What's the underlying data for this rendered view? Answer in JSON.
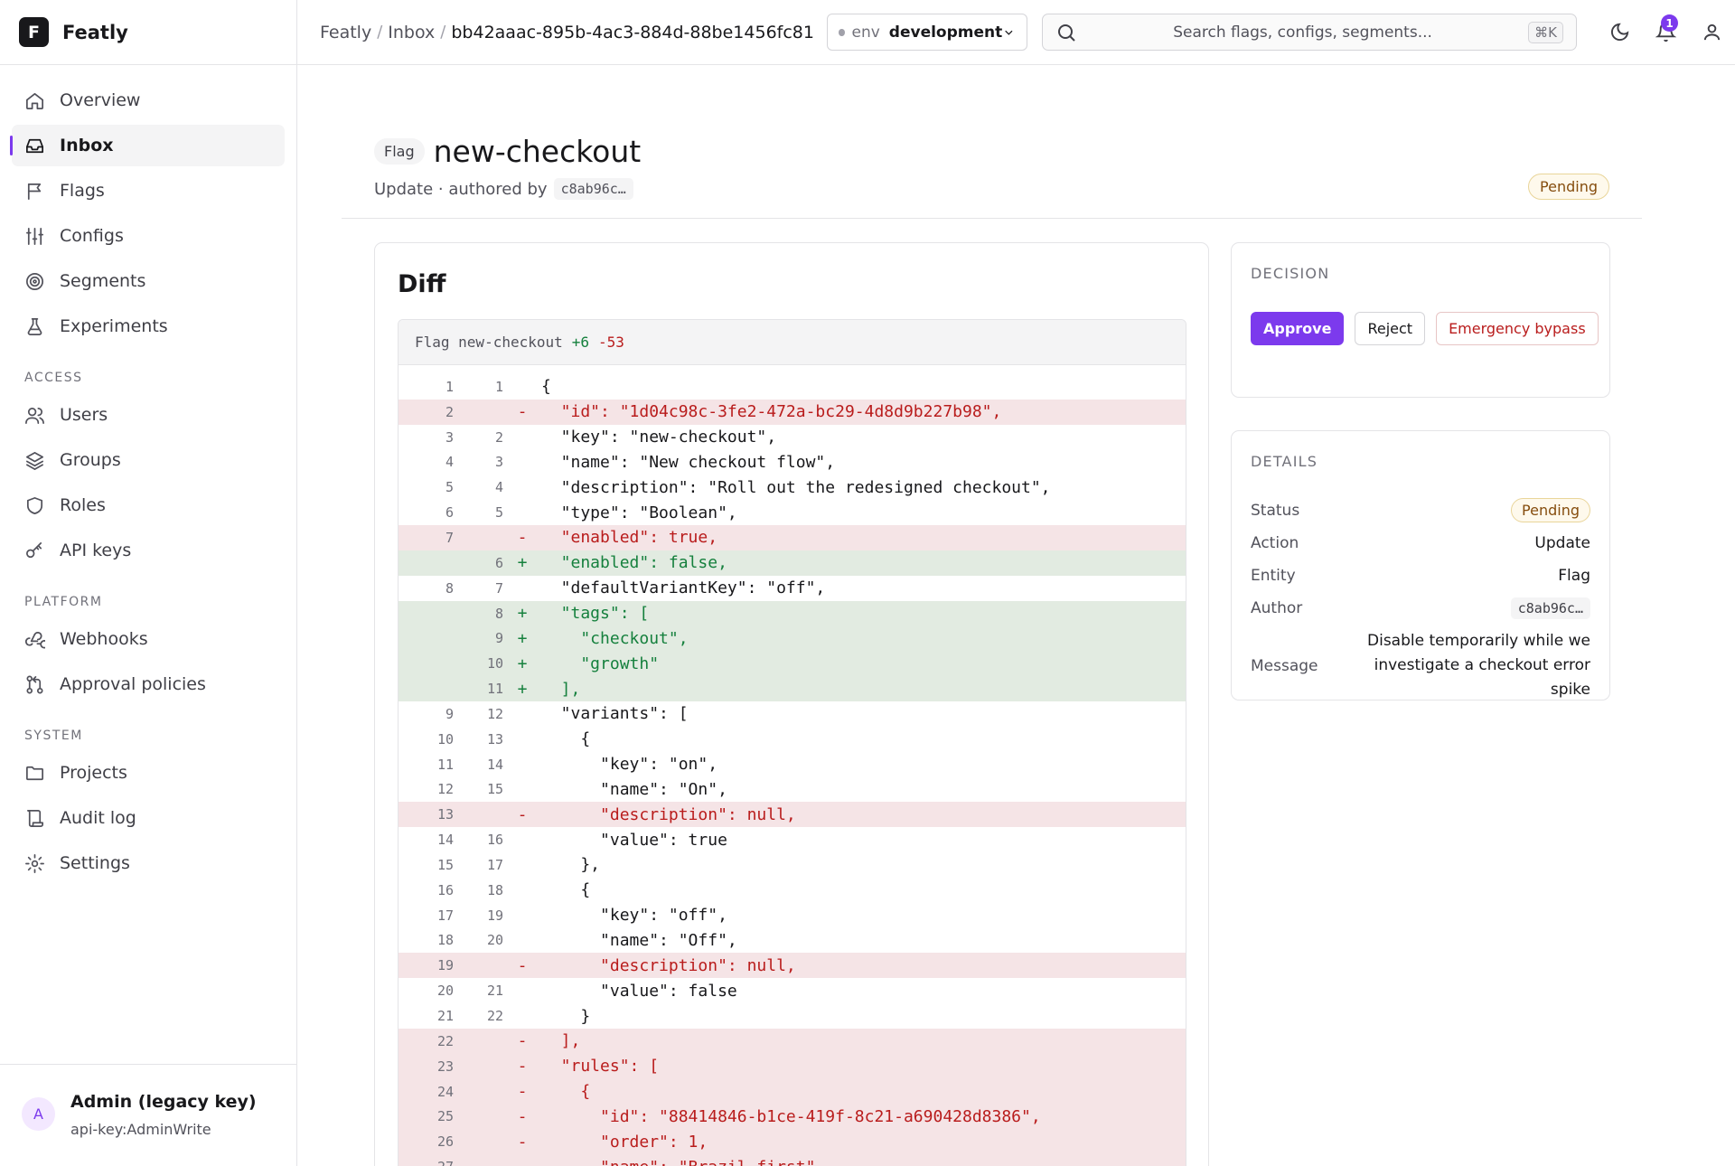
{
  "app": {
    "logo_letter": "F",
    "name": "Featly"
  },
  "nav": {
    "items": [
      {
        "label": "Overview",
        "icon": "home-icon"
      },
      {
        "label": "Inbox",
        "icon": "inbox-icon",
        "active": true
      },
      {
        "label": "Flags",
        "icon": "flag-icon"
      },
      {
        "label": "Configs",
        "icon": "sliders-icon"
      },
      {
        "label": "Segments",
        "icon": "target-icon"
      },
      {
        "label": "Experiments",
        "icon": "flask-icon"
      }
    ],
    "sections": [
      {
        "title": "ACCESS",
        "items": [
          {
            "label": "Users",
            "icon": "users-icon"
          },
          {
            "label": "Groups",
            "icon": "layers-icon"
          },
          {
            "label": "Roles",
            "icon": "shield-icon"
          },
          {
            "label": "API keys",
            "icon": "key-icon"
          }
        ]
      },
      {
        "title": "PLATFORM",
        "items": [
          {
            "label": "Webhooks",
            "icon": "webhook-icon"
          },
          {
            "label": "Approval policies",
            "icon": "git-pull-request-icon"
          }
        ]
      },
      {
        "title": "SYSTEM",
        "items": [
          {
            "label": "Projects",
            "icon": "folder-icon"
          },
          {
            "label": "Audit log",
            "icon": "scroll-icon"
          },
          {
            "label": "Settings",
            "icon": "gear-icon"
          }
        ]
      }
    ]
  },
  "user": {
    "initial": "A",
    "name": "Admin (legacy key)",
    "key": "api-key:AdminWrite"
  },
  "topbar": {
    "breadcrumbs": [
      "Featly",
      "Inbox",
      "bb42aaac-895b-4ac3-884d-88be1456fc81"
    ],
    "env_label": "env",
    "env_value": "development",
    "search_placeholder": "Search flags, configs, segments...",
    "search_shortcut": "⌘K",
    "notification_count": "1"
  },
  "header": {
    "type_chip": "Flag",
    "title": "new-checkout",
    "subtitle_prefix": "Update · authored by",
    "author_hash": "c8ab96c…",
    "status": "Pending"
  },
  "diff": {
    "title": "Diff",
    "head_label": "Flag new-checkout",
    "additions": "+6",
    "deletions": "-53",
    "lines": [
      {
        "old": "1",
        "new": "1",
        "type": "ctx",
        "text": "{"
      },
      {
        "old": "2",
        "new": "",
        "type": "del",
        "text": "  \"id\": \"1d04c98c-3fe2-472a-bc29-4d8d9b227b98\","
      },
      {
        "old": "3",
        "new": "2",
        "type": "ctx",
        "text": "  \"key\": \"new-checkout\","
      },
      {
        "old": "4",
        "new": "3",
        "type": "ctx",
        "text": "  \"name\": \"New checkout flow\","
      },
      {
        "old": "5",
        "new": "4",
        "type": "ctx",
        "text": "  \"description\": \"Roll out the redesigned checkout\","
      },
      {
        "old": "6",
        "new": "5",
        "type": "ctx",
        "text": "  \"type\": \"Boolean\","
      },
      {
        "old": "7",
        "new": "",
        "type": "del",
        "text": "  \"enabled\": true,"
      },
      {
        "old": "",
        "new": "6",
        "type": "add",
        "text": "  \"enabled\": false,"
      },
      {
        "old": "8",
        "new": "7",
        "type": "ctx",
        "text": "  \"defaultVariantKey\": \"off\","
      },
      {
        "old": "",
        "new": "8",
        "type": "add",
        "text": "  \"tags\": ["
      },
      {
        "old": "",
        "new": "9",
        "type": "add",
        "text": "    \"checkout\","
      },
      {
        "old": "",
        "new": "10",
        "type": "add",
        "text": "    \"growth\""
      },
      {
        "old": "",
        "new": "11",
        "type": "add",
        "text": "  ],"
      },
      {
        "old": "9",
        "new": "12",
        "type": "ctx",
        "text": "  \"variants\": ["
      },
      {
        "old": "10",
        "new": "13",
        "type": "ctx",
        "text": "    {"
      },
      {
        "old": "11",
        "new": "14",
        "type": "ctx",
        "text": "      \"key\": \"on\","
      },
      {
        "old": "12",
        "new": "15",
        "type": "ctx",
        "text": "      \"name\": \"On\","
      },
      {
        "old": "13",
        "new": "",
        "type": "del",
        "text": "      \"description\": null,"
      },
      {
        "old": "14",
        "new": "16",
        "type": "ctx",
        "text": "      \"value\": true"
      },
      {
        "old": "15",
        "new": "17",
        "type": "ctx",
        "text": "    },"
      },
      {
        "old": "16",
        "new": "18",
        "type": "ctx",
        "text": "    {"
      },
      {
        "old": "17",
        "new": "19",
        "type": "ctx",
        "text": "      \"key\": \"off\","
      },
      {
        "old": "18",
        "new": "20",
        "type": "ctx",
        "text": "      \"name\": \"Off\","
      },
      {
        "old": "19",
        "new": "",
        "type": "del",
        "text": "      \"description\": null,"
      },
      {
        "old": "20",
        "new": "21",
        "type": "ctx",
        "text": "      \"value\": false"
      },
      {
        "old": "21",
        "new": "22",
        "type": "ctx",
        "text": "    }"
      },
      {
        "old": "22",
        "new": "",
        "type": "del",
        "text": "  ],"
      },
      {
        "old": "23",
        "new": "",
        "type": "del",
        "text": "  \"rules\": ["
      },
      {
        "old": "24",
        "new": "",
        "type": "del",
        "text": "    {"
      },
      {
        "old": "25",
        "new": "",
        "type": "del",
        "text": "      \"id\": \"88414846-b1ce-419f-8c21-a690428d8386\","
      },
      {
        "old": "26",
        "new": "",
        "type": "del",
        "text": "      \"order\": 1,"
      },
      {
        "old": "27",
        "new": "",
        "type": "del",
        "text": "      \"name\": \"Brazil first\","
      }
    ]
  },
  "decision": {
    "label": "DECISION",
    "approve": "Approve",
    "reject": "Reject",
    "bypass": "Emergency bypass"
  },
  "details": {
    "label": "DETAILS",
    "status_key": "Status",
    "status_value": "Pending",
    "action_key": "Action",
    "action_value": "Update",
    "entity_key": "Entity",
    "entity_value": "Flag",
    "author_key": "Author",
    "author_value": "c8ab96c…",
    "message_key": "Message",
    "message_value": "Disable temporarily while we investigate a checkout error spike"
  },
  "colors": {
    "accent": "#7c3aed",
    "pending": "#854d0e",
    "added": "#15803d",
    "removed": "#b91c1c"
  }
}
